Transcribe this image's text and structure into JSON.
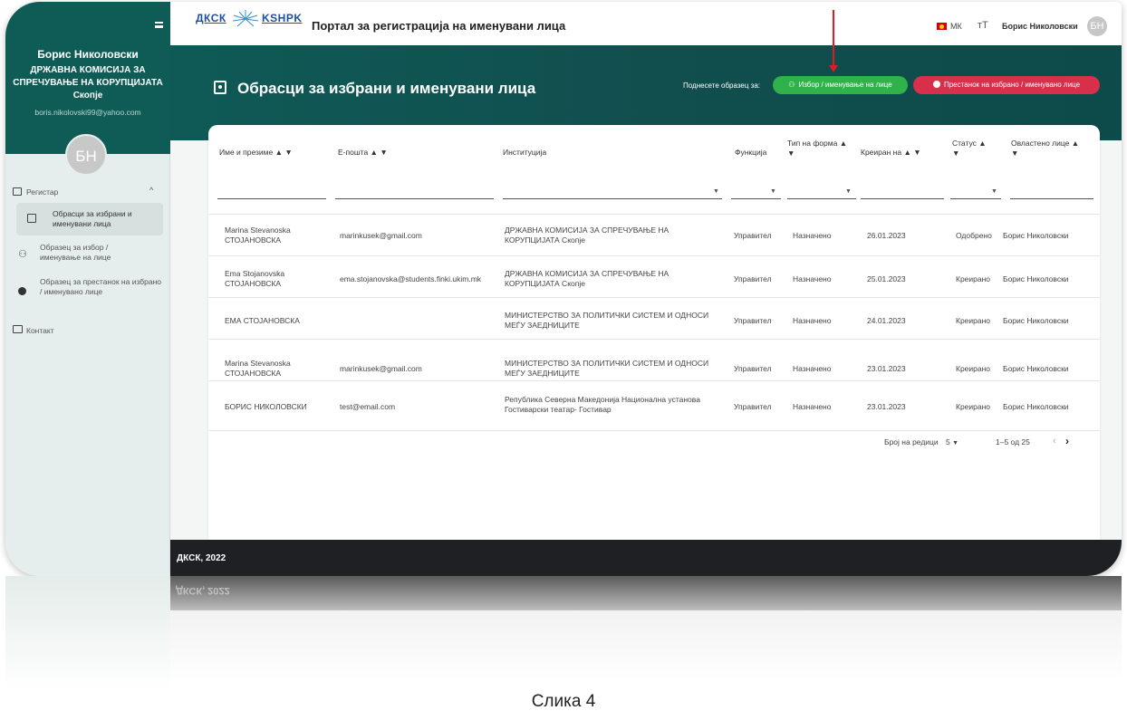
{
  "sidebar": {
    "user_name": "Борис Николовски",
    "user_org": "ДРЖАВНА КОМИСИЈА ЗА СПРЕЧУВАЊЕ НА КОРУПЦИЈАТА Скопје",
    "user_email": "boris.nikolovski99@yahoo.com",
    "avatar_initials": "БН",
    "items": [
      {
        "label": "Регистар",
        "icon": "register-icon"
      },
      {
        "label": "Обрасци за избрани и именувани лица",
        "icon": "form-icon"
      },
      {
        "label": "Образец за избор / именување на лице",
        "icon": "person-add-icon"
      },
      {
        "label": "Образец за престанок на избрано / именувано лице",
        "icon": "remove-circle-icon"
      },
      {
        "label": "Контакт",
        "icon": "contact-card-icon"
      }
    ]
  },
  "topbar": {
    "logo_left": "ДКСК",
    "logo_right": "KSHPK",
    "portal_title": "Портал за регистрација на именувани лица",
    "language": "МК",
    "user_name": "Борис Николовски",
    "avatar_initials": "БН"
  },
  "banner": {
    "page_title": "Обрасци за избрани и именувани лица",
    "submit_label": "Поднесете образец за:",
    "btn_elect": "Избор / именување на лице",
    "btn_term": "Престанок на избрано / именувано лице",
    "btn_elect_color": "#2fb24a",
    "btn_term_color": "#d82f4b"
  },
  "table": {
    "columns": {
      "name": "Име и презиме",
      "email": "Е-пошта",
      "institution": "Институција",
      "function": "Функција",
      "form_type": "Тип на форма",
      "created": "Креиран на",
      "status": "Статус",
      "authorized": "Овластено лице"
    },
    "rows": [
      {
        "name1": "Marina Stevanoska",
        "name2": "СТОЈАНОВСКА",
        "email": "marinkusek@gmail.com",
        "inst1": "ДРЖАВНА КОМИСИЈА ЗА СПРЕЧУВАЊЕ НА",
        "inst2": "КОРУПЦИЈАТА Скопје",
        "function": "Управител",
        "form_type": "Назначено",
        "created": "26.01.2023",
        "status": "Одобрено",
        "authorized": "Борис Николовски"
      },
      {
        "name1": "Ema Stojanovska",
        "name2": "СТОЈАНОВСКА",
        "email": "ema.stojanovska@students.finki.ukim.mk",
        "inst1": "ДРЖАВНА КОМИСИЈА ЗА СПРЕЧУВАЊЕ НА",
        "inst2": "КОРУПЦИЈАТА Скопје",
        "function": "Управител",
        "form_type": "Назначено",
        "created": "25.01.2023",
        "status": "Креирано",
        "authorized": "Борис Николовски"
      },
      {
        "name1": "ЕМА СТОЈАНОВСКА",
        "name2": "",
        "email": "",
        "inst1": "МИНИСТЕРСТВО ЗА ПОЛИТИЧКИ СИСТЕМ И ОДНОСИ",
        "inst2": "МЕЃУ ЗАЕДНИЦИТЕ",
        "function": "Управител",
        "form_type": "Назначено",
        "created": "24.01.2023",
        "status": "Креирано",
        "authorized": "Борис Николовски"
      },
      {
        "name1": "Marina Stevanoska",
        "name2": "СТОЈАНОВСКА",
        "email": "marinkusek@gmail.com",
        "inst1": "МИНИСТЕРСТВО ЗА ПОЛИТИЧКИ СИСТЕМ И ОДНОСИ",
        "inst2": "МЕЃУ ЗАЕДНИЦИТЕ",
        "function": "Управител",
        "form_type": "Назначено",
        "created": "23.01.2023",
        "status": "Креирано",
        "authorized": "Борис Николовски"
      },
      {
        "name1": "БОРИС НИКОЛОВСКИ",
        "name2": "",
        "email": "test@email.com",
        "inst1": "Република Северна Македонија Национална установа",
        "inst2": "Гостиварски театар- Гостивар",
        "function": "Управител",
        "form_type": "Назначено",
        "created": "23.01.2023",
        "status": "Креирано",
        "authorized": "Борис Николовски"
      }
    ],
    "pager": {
      "rows_label": "Број на редици",
      "rows_value": "5",
      "range": "1–5 од 25"
    }
  },
  "footer": {
    "text": "ДКСК, 2022"
  },
  "caption": "Слика 4"
}
